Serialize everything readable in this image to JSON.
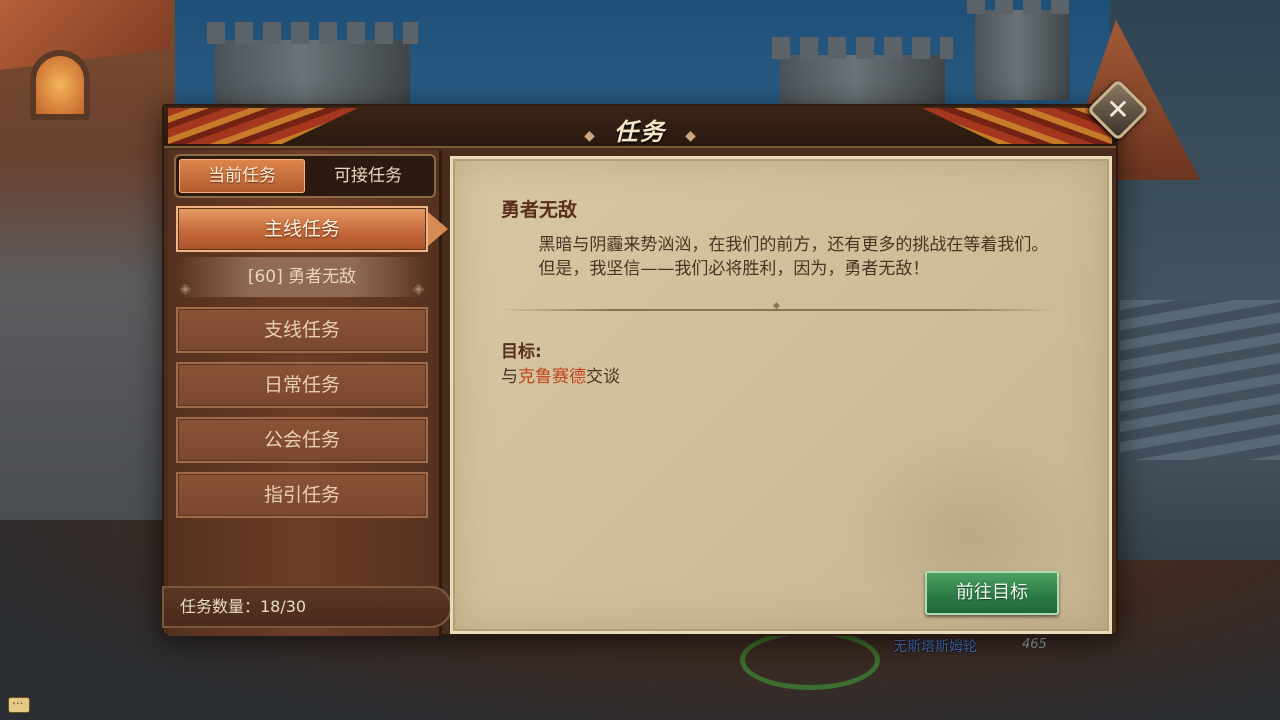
{
  "dialog": {
    "title": "任务",
    "close_icon": "✕"
  },
  "tabs": [
    {
      "label": "当前任务",
      "active": true
    },
    {
      "label": "可接任务",
      "active": false
    }
  ],
  "menu": {
    "main": "主线任务",
    "sub_quest": "[60] 勇者无敌",
    "branch": "支线任务",
    "daily": "日常任务",
    "guild": "公会任务",
    "guide": "指引任务"
  },
  "quest_count": "任务数量：18/30",
  "quest": {
    "title": "勇者无敌",
    "desc_1": "黑暗与阴霾来势汹汹，在我们的前方，还有更多的挑战在等着我们。",
    "desc_2": "但是，我坚信——我们必将胜利，因为，勇者无敌！",
    "goal_label": "目标:",
    "goal_prefix": "与",
    "goal_npc": "克鲁赛德",
    "goal_suffix": "交谈",
    "goto_button": "前往目标"
  },
  "scene": {
    "npc_name": "无斯塔斯姆轮",
    "npc_level": "465"
  },
  "colors": {
    "accent_orange": "#c2673a",
    "goal_npc": "#c4441f",
    "goto_green": "#2c7c46"
  }
}
